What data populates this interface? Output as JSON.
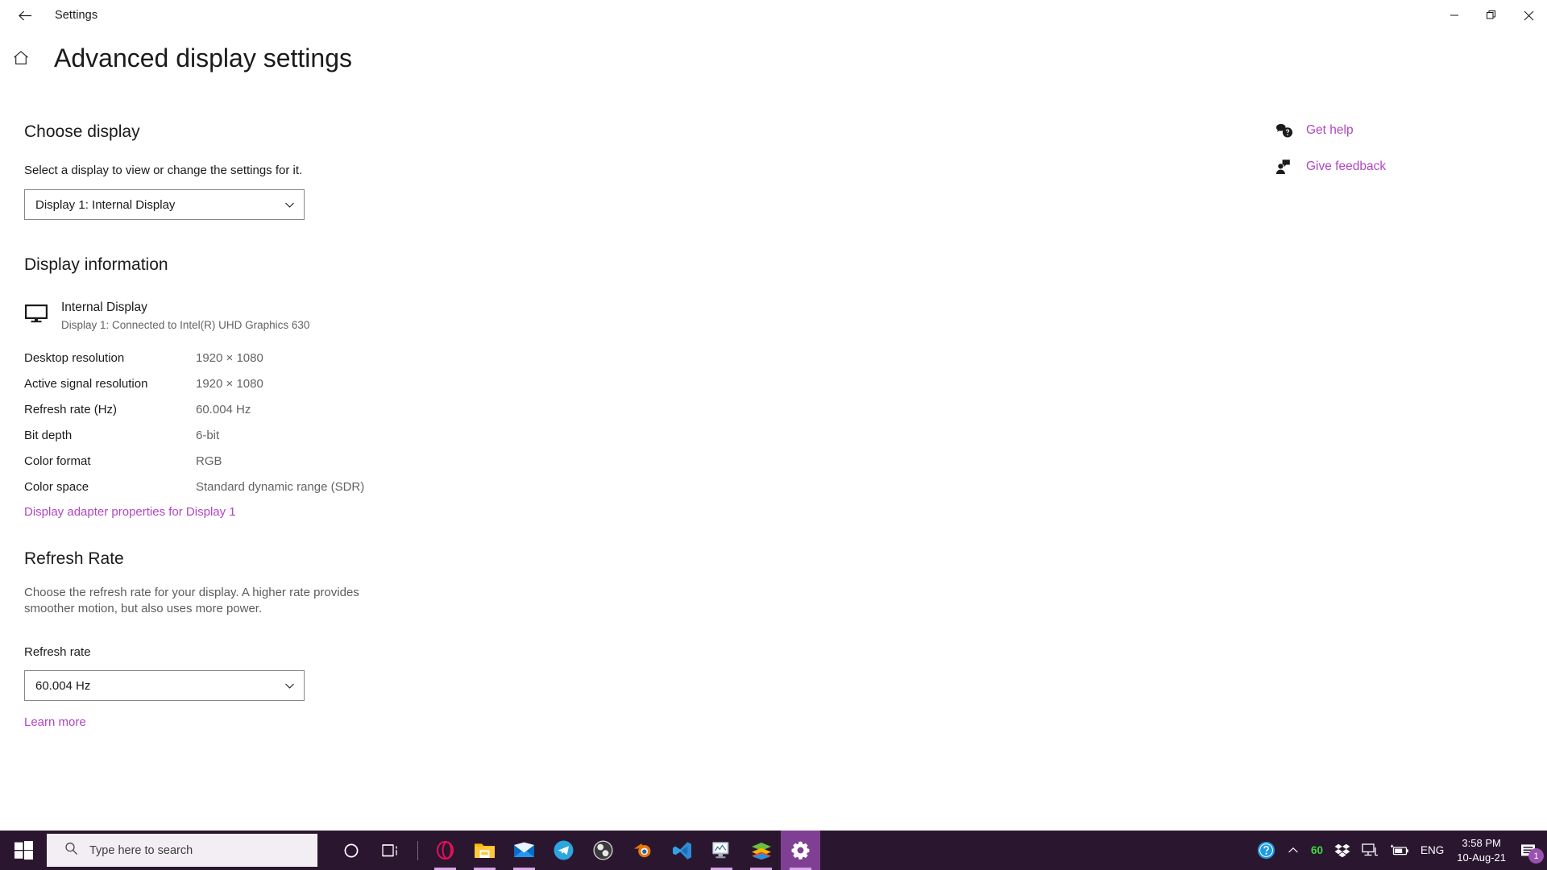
{
  "window": {
    "app_title": "Settings",
    "back_icon": "back-arrow-icon",
    "minimize_label": "Minimize",
    "restore_label": "Restore",
    "close_label": "Close"
  },
  "header": {
    "home_icon": "home-icon",
    "title": "Advanced display settings"
  },
  "choose_display": {
    "heading": "Choose display",
    "description": "Select a display to view or change the settings for it.",
    "dropdown_value": "Display 1: Internal Display"
  },
  "display_information": {
    "heading": "Display information",
    "monitor_icon": "monitor-icon",
    "display_name": "Internal Display",
    "display_subtitle": "Display 1: Connected to Intel(R) UHD Graphics 630",
    "rows": [
      {
        "key": "Desktop resolution",
        "value": "1920 × 1080"
      },
      {
        "key": "Active signal resolution",
        "value": "1920 × 1080"
      },
      {
        "key": "Refresh rate (Hz)",
        "value": "60.004 Hz"
      },
      {
        "key": "Bit depth",
        "value": "6-bit"
      },
      {
        "key": "Color format",
        "value": "RGB"
      },
      {
        "key": "Color space",
        "value": "Standard dynamic range (SDR)"
      }
    ],
    "adapter_link": "Display adapter properties for Display 1"
  },
  "refresh_rate": {
    "heading": "Refresh Rate",
    "description": "Choose the refresh rate for your display. A higher rate provides smoother motion, but also uses more power.",
    "field_label": "Refresh rate",
    "dropdown_value": "60.004 Hz",
    "learn_more": "Learn more"
  },
  "right_rail": [
    {
      "icon": "help-chat-icon",
      "label": "Get help"
    },
    {
      "icon": "feedback-person-icon",
      "label": "Give feedback"
    }
  ],
  "taskbar": {
    "start_icon": "windows-start-icon",
    "search_placeholder": "Type here to search",
    "search_icon": "search-icon",
    "apps": [
      {
        "icon": "cortana-icon",
        "name": "Cortana",
        "running": false,
        "active": false
      },
      {
        "icon": "task-view-icon",
        "name": "Task View",
        "running": false,
        "active": false
      },
      {
        "icon": "opera-icon",
        "name": "Opera",
        "running": true,
        "active": false
      },
      {
        "icon": "file-explorer-icon",
        "name": "File Explorer",
        "running": true,
        "active": false
      },
      {
        "icon": "mail-icon",
        "name": "Mail",
        "running": true,
        "active": false
      },
      {
        "icon": "telegram-icon",
        "name": "Telegram",
        "running": false,
        "active": false
      },
      {
        "icon": "obs-studio-icon",
        "name": "OBS Studio",
        "running": false,
        "active": false
      },
      {
        "icon": "blender-icon",
        "name": "Blender",
        "running": false,
        "active": false
      },
      {
        "icon": "vscode-icon",
        "name": "Visual Studio Code",
        "running": false,
        "active": false
      },
      {
        "icon": "task-manager-icon",
        "name": "Task Manager",
        "running": true,
        "active": false
      },
      {
        "icon": "bluestacks-icon",
        "name": "BlueStacks",
        "running": true,
        "active": false
      },
      {
        "icon": "settings-gear-icon",
        "name": "Settings",
        "running": true,
        "active": true
      }
    ],
    "tray": {
      "help_icon": "help-circle-icon",
      "chevron_icon": "show-hidden-icons-chevron",
      "battery_percent": "60",
      "dropbox_icon": "dropbox-icon",
      "network_icon": "network-icon",
      "battery_icon": "battery-charging-icon",
      "language": "ENG",
      "time": "3:58 PM",
      "date": "10-Aug-21",
      "action_center_icon": "action-center-icon",
      "notification_count": "1"
    }
  },
  "colors": {
    "accent_link": "#b146c2",
    "taskbar_bg": "#2b1630",
    "taskbar_active": "#7f3f92"
  }
}
